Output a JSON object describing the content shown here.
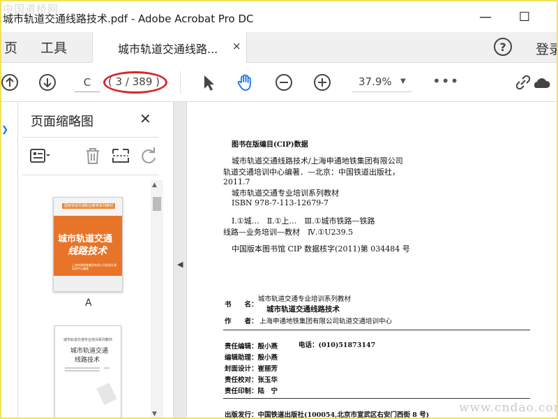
{
  "watermark_top": "中国道桥网",
  "watermark_bottom": "www.cndao.com",
  "window": {
    "title": "城市轨道交通线路技术.pdf - Adobe Acrobat Pro DC",
    "minimize": "—",
    "maximize": "☐"
  },
  "tabs": {
    "home": "页",
    "tools": "工具",
    "document": "城市轨道交通线路...",
    "close": "×",
    "help": "?",
    "login": "登录"
  },
  "toolbar": {
    "page_input": "C",
    "page_count": "( 3 / 389 )",
    "zoom": "37.9%",
    "zoom_caret": "▼",
    "more": "•••"
  },
  "panel": {
    "title": "页面缩略图",
    "close": "✕",
    "scroll_up": "▲",
    "scroll_down": "▼",
    "thumb1": {
      "top_band": "国家铁道交通职业教育系列教材",
      "title_line1": "城市轨道交通",
      "title_line2": "线路技术",
      "publisher": "上海申通地铁集团有限公司轨道交通培训中心编著",
      "label": "A"
    },
    "thumb2": {
      "series": "城市轨道交通专业培训系列教材",
      "title_line1": "城市轨道交通",
      "title_line2": "线路技术"
    }
  },
  "document": {
    "cip_header": "图书在版编目(CIP)数据",
    "cip_lines": [
      "城市轨道交通线路技术/上海申通地铁集团有限公司",
      "轨道交通培训中心编著．—北京：中国铁道出版社，",
      "2011.7",
      "城市轨道交通专业培训系列教材",
      "ISBN 978-7-113-12679-7",
      "Ⅰ.①城…　Ⅱ.①上…　Ⅲ.①城市铁路—铁路",
      "线路—业务培训—教材　Ⅳ.①U239.5",
      "中国版本图书馆 CIP 数据核字(2011)第 034484 号"
    ],
    "book_label": "书　　名：",
    "book_series": "城市轨道交通专业培训系列教材",
    "book_title": "城市轨道交通线路技术",
    "author_label": "作　　者：",
    "author": "上海申通地铁集团有限公司轨道交通培训中心",
    "editor": "责任编辑：殷小燕",
    "phone": "电话：(010)51873147",
    "assistant": "编辑助理：殷小燕",
    "cover": "封面设计：崔丽芳",
    "proof": "责任校对：张玉华",
    "print": "责任印制：陆　宁",
    "publisher": "出版发行：中国铁道出版社(100054,北京市宣武区右安门西街 8 号)"
  }
}
